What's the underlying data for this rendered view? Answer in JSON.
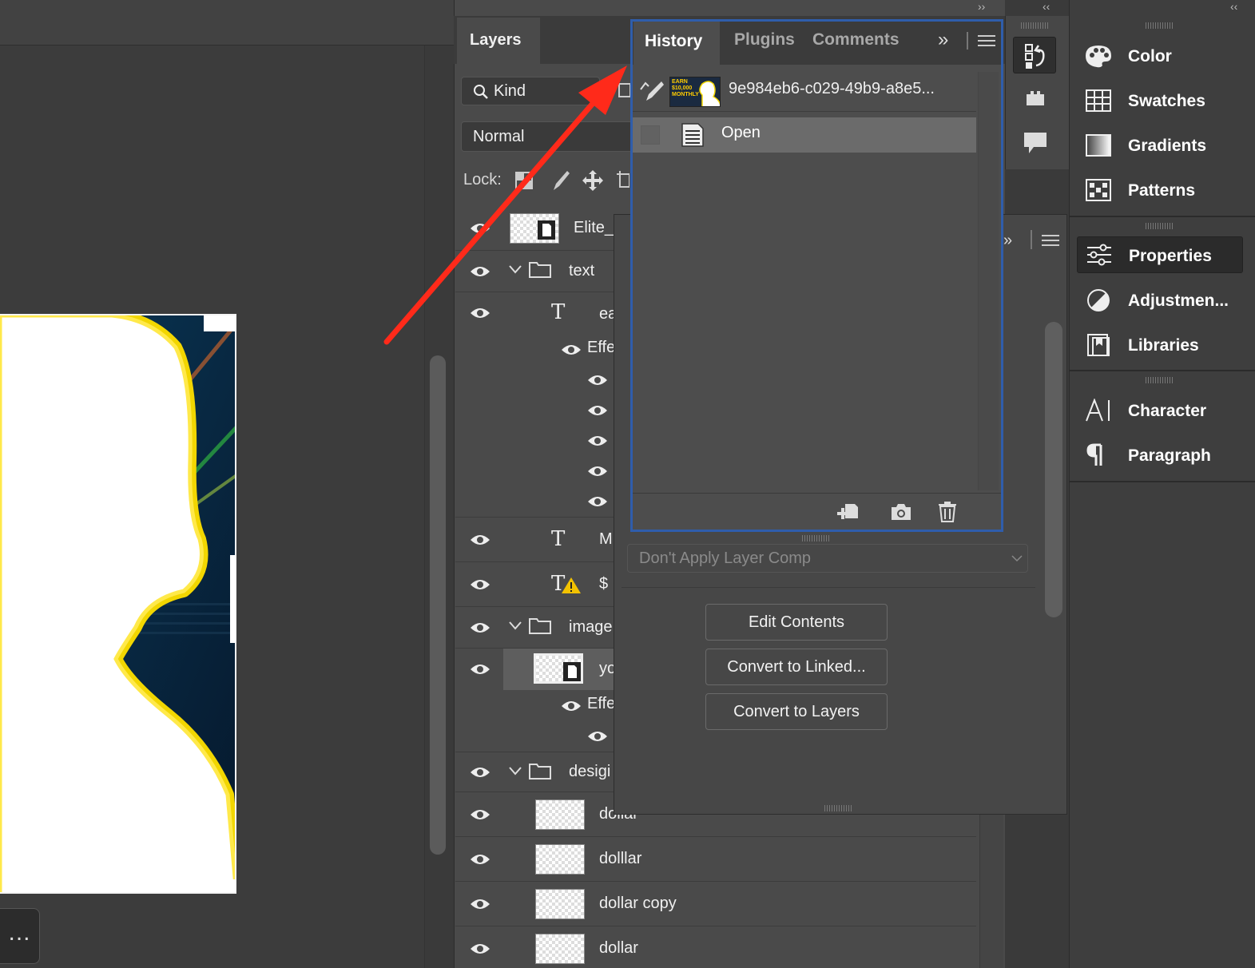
{
  "layers_panel": {
    "tab_label": "Layers",
    "kind_filter": "Kind",
    "blend_mode": "Normal",
    "lock_label": "Lock:",
    "layers": [
      {
        "name": "Elite_"
      },
      {
        "name": "text"
      },
      {
        "name": "ea"
      },
      {
        "name": "Effe"
      },
      {
        "name": "M"
      },
      {
        "name": "$"
      },
      {
        "name": "image"
      },
      {
        "name": "yo"
      },
      {
        "name": "Effe"
      },
      {
        "name": "desigi"
      },
      {
        "name": "dollar"
      },
      {
        "name": "dolllar"
      },
      {
        "name": "dollar copy"
      },
      {
        "name": "dollar"
      }
    ]
  },
  "history_panel": {
    "tabs": [
      "History",
      "Plugins",
      "Comments"
    ],
    "snapshot_name": "9e984eb6-c029-49b9-a8e5...",
    "snapshot_thumb_text": "EARN $10,000 MONTHLY",
    "states": [
      "Open"
    ]
  },
  "properties_panel": {
    "layer_comp": "Don't Apply Layer Comp",
    "buttons": [
      "Edit Contents",
      "Convert to Linked...",
      "Convert to Layers"
    ]
  },
  "right_dock": {
    "items": [
      "Color",
      "Swatches",
      "Gradients",
      "Patterns",
      "Properties",
      "Adjustmen...",
      "Libraries",
      "Character",
      "Paragraph"
    ]
  },
  "canvas": {
    "more_button": "..."
  },
  "colors": {
    "annotation_arrow": "#ff2a1a",
    "history_border": "#2f5dab",
    "glow": "#f2d600"
  }
}
